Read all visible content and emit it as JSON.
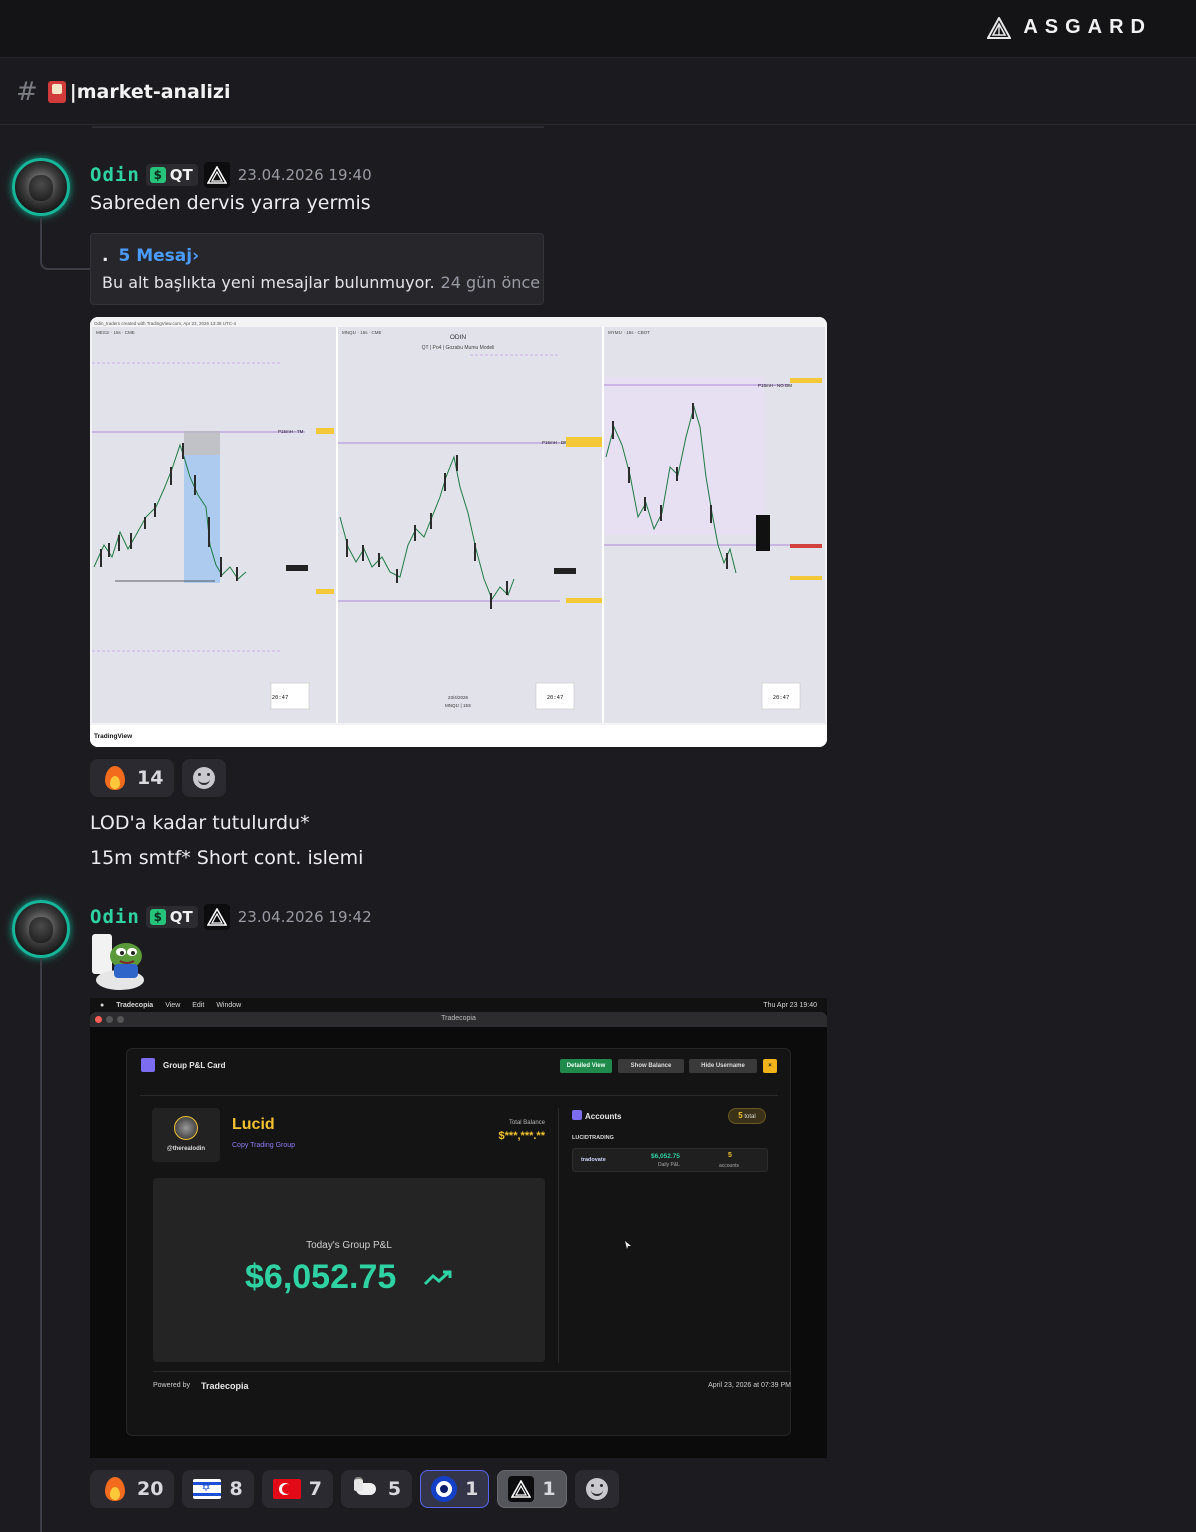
{
  "app": {
    "brand": "ASGARD"
  },
  "channel": {
    "name": "|market-analizi"
  },
  "messages": [
    {
      "author": "Odin",
      "role": "QT",
      "timestamp": "23.04.2026 19:40",
      "text": "Sabreden dervis yarra yermis",
      "thread": {
        "bullet": ".",
        "title": "5 Mesaj›",
        "body": "Bu alt başlıkta yeni mesajlar bulunmuyor.",
        "ago": "24 gün önce"
      },
      "reactions": [
        {
          "icon": "fire-emoji",
          "count": "14"
        }
      ],
      "followups": [
        "LOD'a kadar tutulurdu*",
        "15m smtf* Short cont. islemi"
      ]
    },
    {
      "author": "Odin",
      "role": "QT",
      "timestamp": "23.04.2026 19:42",
      "reactions": [
        {
          "icon": "fire-emoji",
          "count": "20"
        },
        {
          "icon": "israel-flag-emoji",
          "count": "8"
        },
        {
          "icon": "turkey-flag-emoji",
          "count": "7"
        },
        {
          "icon": "goat-emoji",
          "count": "5"
        },
        {
          "icon": "nazar-emoji",
          "count": "1"
        },
        {
          "icon": "asgard-emoji",
          "count": "1"
        }
      ]
    }
  ],
  "chart_image": {
    "header": "Odin_traders created with TradingView.com, Apr 23, 2026 13:38 UTC-4",
    "footer": "TradingView",
    "center_title": "ODIN",
    "center_subtitle": "QT | Po4 | Gozabu Mumu Modeli",
    "center_date": "23/4/2026",
    "center_symbol": "MNQ1! | 15S",
    "pane_symbols": [
      "MES1! · 15s · CME",
      "MNQ1! · 15s · CME",
      "MYM1! · 15s · CBOT"
    ],
    "pane_labels": [
      "P15mH - TM",
      "P15mH - DM",
      "P15mH - NO DM"
    ],
    "timer": "20:47",
    "timer_title": "30m CANDLE PO3"
  },
  "tradecopia": {
    "menubar": [
      "Tradecopia",
      "View",
      "Edit",
      "Window"
    ],
    "menubar_right": "Thu Apr 23  19:40",
    "window_title": "Tradecopia",
    "card_title": "Group P&L Card",
    "btn_detailed": "Detailed View",
    "btn_balance": "Show Balance",
    "btn_hide": "Hide Username",
    "btn_close": "×",
    "username": "@therealodin",
    "name": "Lucid",
    "group": "Copy Trading Group",
    "total_balance_label": "Total Balance",
    "total_balance": "$***,***.**",
    "pnl_label": "Today's Group P&L",
    "pnl_value": "$6,052.75",
    "accounts_title": "Accounts",
    "accounts_total_num": "5",
    "accounts_total_word": "total",
    "section": "LUCIDTRADING",
    "row_broker": "tradovate",
    "row_pnl": "$6,052.75",
    "row_pnl_label": "Daily P&L",
    "row_accounts": "5",
    "row_accounts_label": "accounts",
    "powered": "Powered by",
    "powered_brand": "Tradecopia",
    "footer_date": "April 23, 2026 at 07:39 PM"
  }
}
